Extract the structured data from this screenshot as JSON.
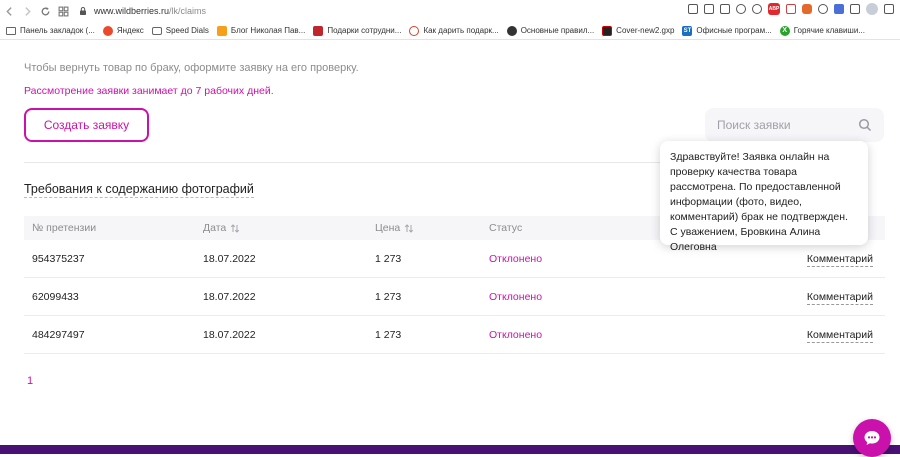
{
  "browser": {
    "url_host": "www.wildberries.ru",
    "url_path": "/lk/claims",
    "bookmarks": [
      {
        "label": "Панель закладок (...",
        "icon": "folder-icon"
      },
      {
        "label": "Яндекс",
        "icon": "yandex-icon"
      },
      {
        "label": "Speed Dials",
        "icon": "speed-dials-icon"
      },
      {
        "label": "Блог Николая Пав...",
        "icon": "blog-icon"
      },
      {
        "label": "Подарки сотрудни...",
        "icon": "gift-icon"
      },
      {
        "label": "Как дарить подарк...",
        "icon": "gift-tips-icon"
      },
      {
        "label": "Основные правил...",
        "icon": "rules-icon"
      },
      {
        "label": "Cover-new2.gxp",
        "icon": "cover-icon"
      },
      {
        "label": "Офисные програм...",
        "icon": "office-icon"
      },
      {
        "label": "Горячие клавиши...",
        "icon": "hotkeys-icon"
      }
    ]
  },
  "page": {
    "intro_text": "Чтобы вернуть товар по браку, оформите заявку на его проверку.",
    "review_time": "Рассмотрение заявки занимает до 7 рабочих дней.",
    "create_button": "Создать заявку",
    "search_placeholder": "Поиск заявки",
    "photo_requirements": "Требования к содержанию фотографий",
    "table": {
      "headers": {
        "id": "№ претензии",
        "date": "Дата",
        "price": "Цена",
        "status": "Статус"
      },
      "rows": [
        {
          "id": "954375237",
          "date": "18.07.2022",
          "price": "1 273",
          "status": "Отклонено",
          "comment": "Комментарий"
        },
        {
          "id": "62099433",
          "date": "18.07.2022",
          "price": "1 273",
          "status": "Отклонено",
          "comment": "Комментарий"
        },
        {
          "id": "484297497",
          "date": "18.07.2022",
          "price": "1 273",
          "status": "Отклонено",
          "comment": "Комментарий"
        }
      ]
    },
    "pagination": {
      "current": "1"
    },
    "tooltip": "Здравствуйте! Заявка онлайн на проверку качества товара рассмотрена. По предоставленной информации (фото, видео, комментарий) брак не подтвержден. С уважением, Бровкина Алина Олеговна"
  },
  "colors": {
    "accent": "#cb11ab",
    "footer": "#481173"
  }
}
